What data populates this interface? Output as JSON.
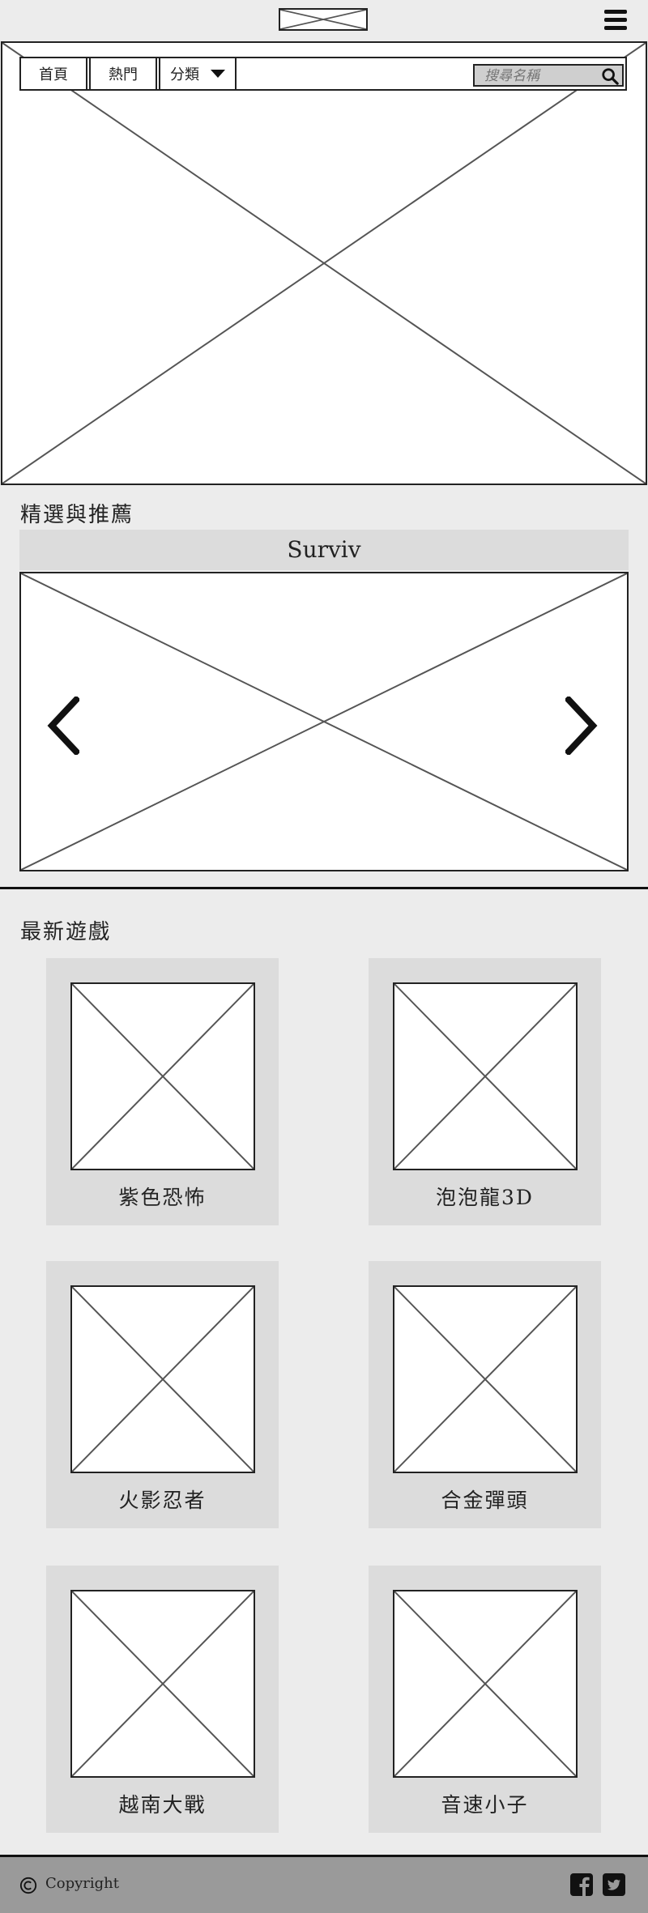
{
  "header": {
    "menu_icon": "hamburger-icon"
  },
  "nav": {
    "home": "首頁",
    "popular": "熱門",
    "category": "分類",
    "search_placeholder": "搜尋名稱"
  },
  "featured": {
    "title": "精選與推薦",
    "current_game": "Surviv"
  },
  "latest": {
    "title": "最新遊戲",
    "games": [
      "紫色恐怖",
      "泡泡龍3D",
      "火影忍者",
      "合金彈頭",
      "越南大戰",
      "音速小子"
    ]
  },
  "footer": {
    "copyright": "Copyright",
    "social": [
      "facebook-icon",
      "twitter-icon"
    ]
  }
}
